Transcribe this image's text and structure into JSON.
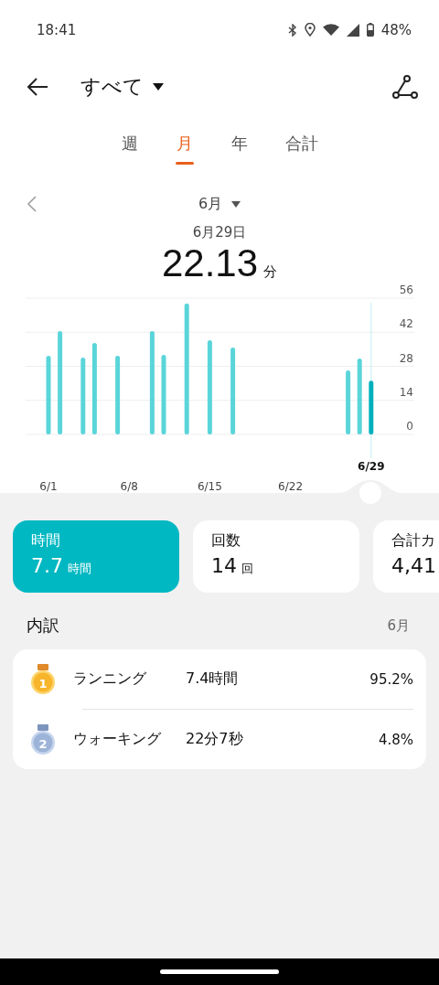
{
  "status_bar": {
    "time": "18:41",
    "battery": "48%"
  },
  "header": {
    "title": "すべて"
  },
  "tabs": [
    {
      "label": "週",
      "selected": false
    },
    {
      "label": "月",
      "selected": true
    },
    {
      "label": "年",
      "selected": false
    },
    {
      "label": "合計",
      "selected": false
    }
  ],
  "period": {
    "month": "6月",
    "date": "6月29日",
    "value": "22.13",
    "unit": "分"
  },
  "chart": {
    "selected_label": "6/29",
    "chart_data": {
      "type": "bar",
      "categories": [
        "6/1",
        null,
        null,
        null,
        null,
        null,
        null,
        "6/8",
        null,
        null,
        null,
        null,
        null,
        null,
        "6/15",
        null,
        null,
        null,
        null,
        null,
        null,
        "6/22",
        null,
        null,
        null,
        null,
        null,
        null,
        null,
        null
      ],
      "values": [
        32.3,
        42.5,
        null,
        31.6,
        37.6,
        null,
        32.3,
        null,
        null,
        42.5,
        32.7,
        null,
        53.8,
        null,
        38.7,
        null,
        35.7,
        null,
        null,
        null,
        null,
        null,
        null,
        null,
        null,
        null,
        26.3,
        31.2,
        22.1,
        null
      ],
      "grid": true,
      "ylim": [
        0,
        56
      ],
      "yticks": [
        0,
        14,
        28,
        42,
        56
      ]
    }
  },
  "summary_cards": [
    {
      "label": "時間",
      "value": "7.7",
      "unit": "時間",
      "selected": true
    },
    {
      "label": "回数",
      "value": "14",
      "unit": "回",
      "selected": false
    },
    {
      "label": "合計カ",
      "value": "4,41",
      "selected": false
    }
  ],
  "breakdown": {
    "title": "内訳",
    "period": "6月",
    "rows": [
      {
        "rank": "1",
        "name": "ランニング",
        "duration": "7.4時間",
        "share": "95.2%"
      },
      {
        "rank": "2",
        "name": "ウォーキング",
        "duration": "22分7秒",
        "share": "4.8%"
      }
    ]
  }
}
